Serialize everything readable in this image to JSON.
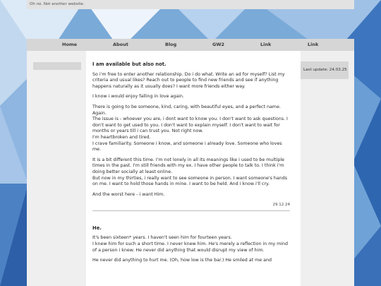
{
  "header": {
    "tagline": "Oh no. Not another website."
  },
  "nav": [
    "Home",
    "About",
    "Blog",
    "GW2",
    "Link",
    "Link"
  ],
  "sidebar": {
    "last_update": "Last update: 24.03.25"
  },
  "posts": [
    {
      "title": "I am available but also not.",
      "paragraphs": [
        "So i'm free to enter another relationship. Do i do what. Write an ad for myself? List my criteria and usual likes? Reach out to people to find new friends and see if anything happens naturally as it usually does? I want more friends either way.",
        "I know i would enjoy falling in love again.",
        "There is going to be someone, kind, caring, with beautiful eyes, and a perfect name. Again.\nThe issue is - whoever you are, i dont want to know you. I don't want to ask questions. I don't want to get used to you. I don't want to explain myself. I don't want to wait for months or years till i can trust you. Not right now.\nI'm heartbroken and tired.\nI crave familiarity. Someone i know, and someone i already love. Someone who loves me.",
        "It is a bit different this time. I'm not lonely in all its meanings like i used to be multiple times in the past. I'm still friends with my ex. I have other people to talk to. I think i'm doing better socially at least online.\nBut now in my thirties, i really want to see someone in person. I want someone's hands on me. I want to hold those hands in mine. I want to be held. And i know i'll cry.",
        "And the worst here - i want Him."
      ],
      "date": "29.12.24"
    },
    {
      "title": "He.",
      "paragraphs": [
        "It's been sixteen* years. I haven't seen him for fourteen years.\nI knew him for such a short time. I never knew him. He's merely a reflection in my mind of a person i knew. He never did anything that would disrupt my view of him.",
        "He never did anything to hurt me. (Oh, how low is the bar.) He smiled at me and"
      ]
    }
  ]
}
